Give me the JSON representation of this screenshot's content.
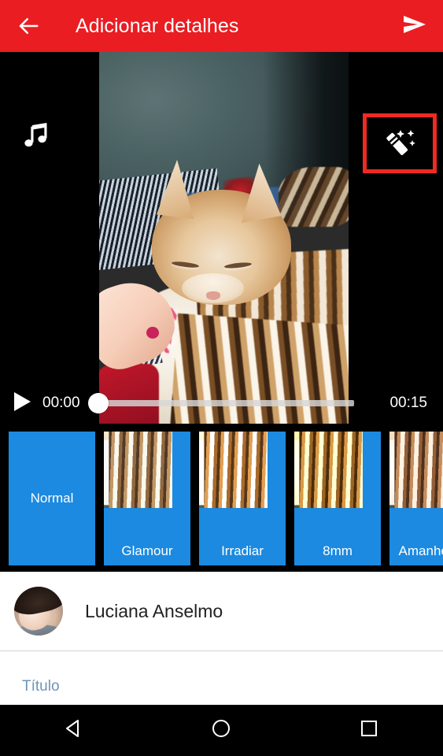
{
  "header": {
    "title": "Adicionar detalhes",
    "back_icon": "arrow-left-icon",
    "send_icon": "send-icon",
    "background_color": "#ea1d22"
  },
  "preview": {
    "music_icon": "music-note-icon",
    "effects_icon": "magic-wand-icon",
    "effects_highlight_color": "#ef2a22"
  },
  "player": {
    "play_icon": "play-icon",
    "current_time": "00:00",
    "total_time": "00:15",
    "progress_percent": 0
  },
  "filters": {
    "items": [
      {
        "label": "Normal",
        "selected": true
      },
      {
        "label": "Glamour",
        "selected": false
      },
      {
        "label": "Irradiar",
        "selected": false
      },
      {
        "label": "8mm",
        "selected": false
      },
      {
        "label": "Amanhecer",
        "selected": false
      }
    ],
    "accent_color": "#1c8ae0"
  },
  "details": {
    "avatar_name": "avatar",
    "user_name": "Luciana Anselmo",
    "title_label": "Título",
    "title_value": "",
    "title_label_color": "#6f93b8"
  },
  "navbar": {
    "back_icon": "nav-back-icon",
    "home_icon": "nav-home-icon",
    "recents_icon": "nav-recents-icon"
  }
}
